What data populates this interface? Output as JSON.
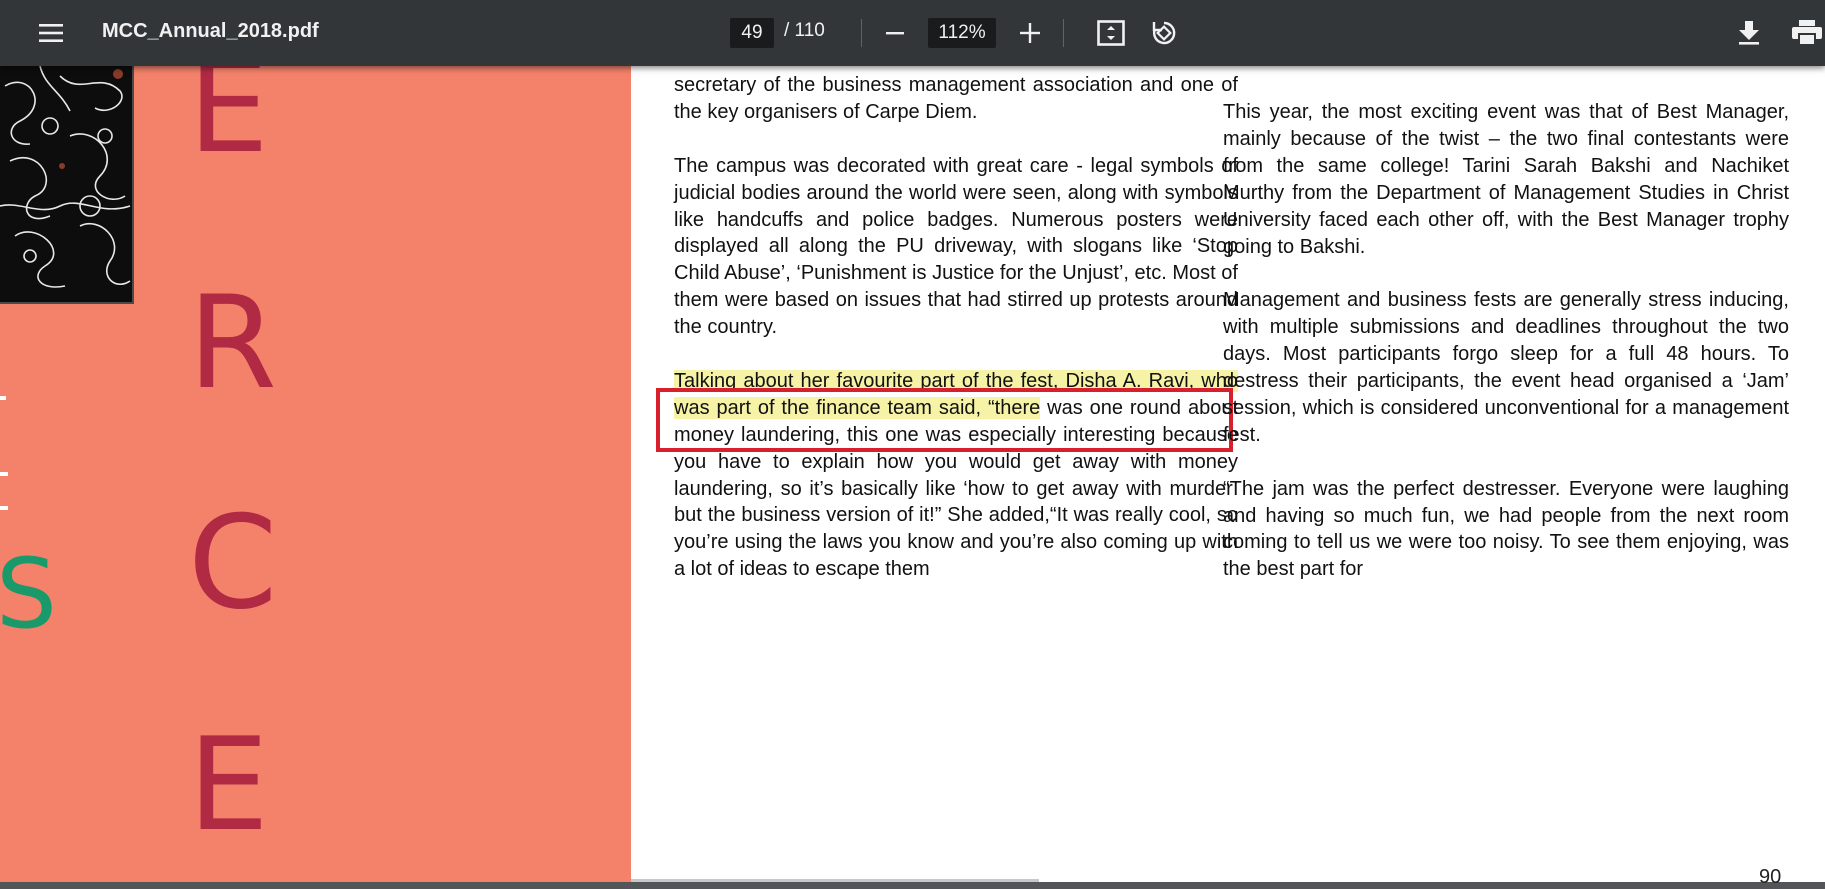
{
  "toolbar": {
    "menu_icon": "hamburger-menu-icon",
    "title": "MCC_Annual_2018.pdf",
    "page_current": "49",
    "page_total": "/ 110",
    "zoom": "112%",
    "icons": [
      "minus-icon",
      "plus-icon",
      "fit-to-page-icon",
      "rotate-icon",
      "download-icon",
      "print-icon"
    ]
  },
  "left_page": {
    "big_letters": [
      "E",
      "R",
      "C",
      "E"
    ],
    "side_letter": "S",
    "colors": {
      "background": "#f4826b",
      "letters": "#b12a44",
      "side_letter": "#1a9a6a"
    }
  },
  "right_page": {
    "column1": {
      "p1": "secretary of the business management association and one of the key organisers of Carpe Diem.",
      "p2": "The campus was decorated with great care - legal symbols of judicial bodies around the world were seen, along with symbols like handcuffs and police badges. Numerous posters were displayed all along the PU driveway, with slogans like ‘Stop Child Abuse’, ‘Punishment is Justice for the Unjust’, etc. Most of them were based on issues that had stirred up protests around the country.",
      "p3_highlight": "Talking about her favourite part of the fest, Disha A. Ravi, who was part of the finance team said, “there",
      "p3_rest": " was one round about money laundering, this one was especially interesting because you have to explain how you would get away with money laundering, so it’s basically like ‘how to get away with murder’ but the business version of it!” She added,“It was really cool, so you’re using the laws you know and you’re also coming up with a lot of ideas to escape them"
    },
    "column2": {
      "p1": "This year, the most exciting event was that of Best Manager, mainly because of the twist – the two final contestants were from the same college! Tarini Sarah Bakshi and Nachiket Murthy from the Department of Management Studies in Christ University faced each other off, with the Best Manager trophy going to Bakshi.",
      "p2": "Management and business fests are generally stress inducing, with multiple submissions and deadlines throughout the two days. Most participants forgo sleep for a full 48 hours. To destress their participants, the event head organised a ‘Jam’ session, which is considered unconventional for a management fest.",
      "p3": "“The jam was the perfect destresser. Everyone were laughing and having so much fun, we had people from the next room coming to tell us we were too noisy. To see them enjoying, was the best part for"
    },
    "page_number": "90",
    "highlight_color": "#f6f3a6",
    "annotation_box_color": "#d8202d"
  }
}
